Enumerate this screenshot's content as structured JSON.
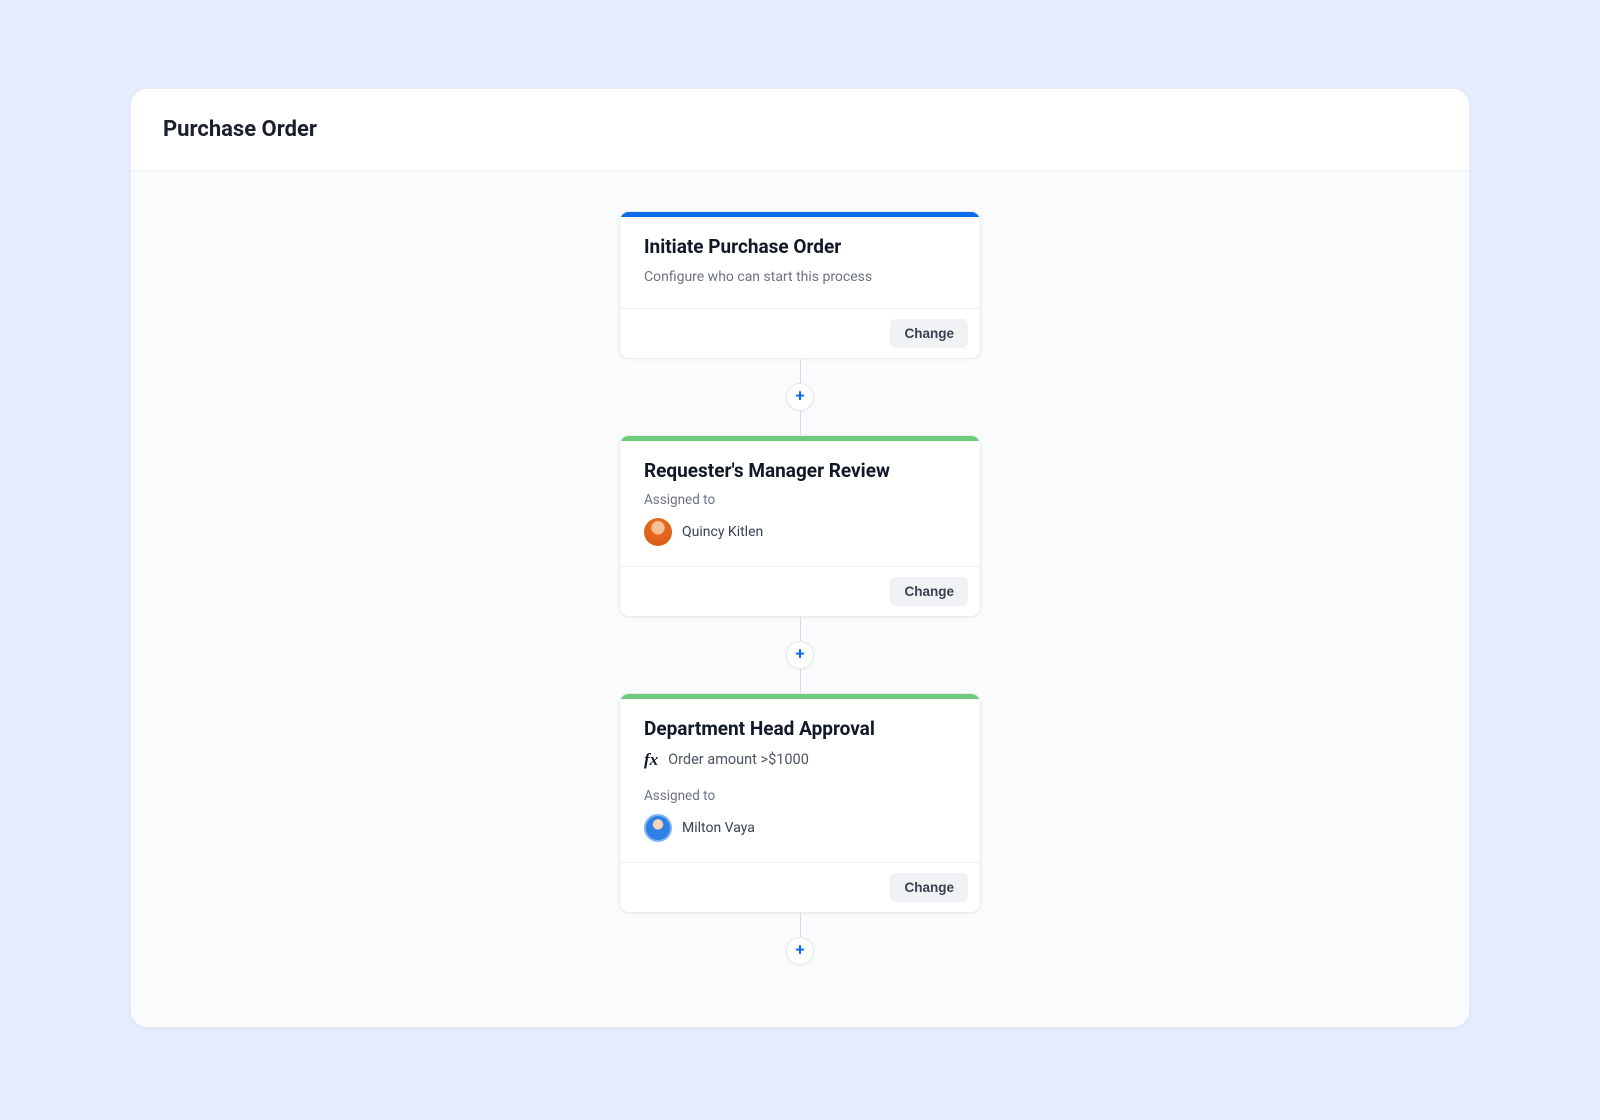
{
  "header": {
    "title": "Purchase Order"
  },
  "flow": {
    "add_label": "+",
    "steps": [
      {
        "accent": "blue",
        "title": "Initiate Purchase Order",
        "subtext": "Configure who can start this process",
        "change_label": "Change"
      },
      {
        "accent": "green",
        "title": "Requester's Manager Review",
        "assigned_label": "Assigned to",
        "assignee_name": "Quincy Kitlen",
        "change_label": "Change"
      },
      {
        "accent": "green",
        "title": "Department Head Approval",
        "condition_icon": "fx",
        "condition_text": "Order amount >$1000",
        "assigned_label": "Assigned to",
        "assignee_name": "Milton Vaya",
        "change_label": "Change"
      }
    ]
  }
}
